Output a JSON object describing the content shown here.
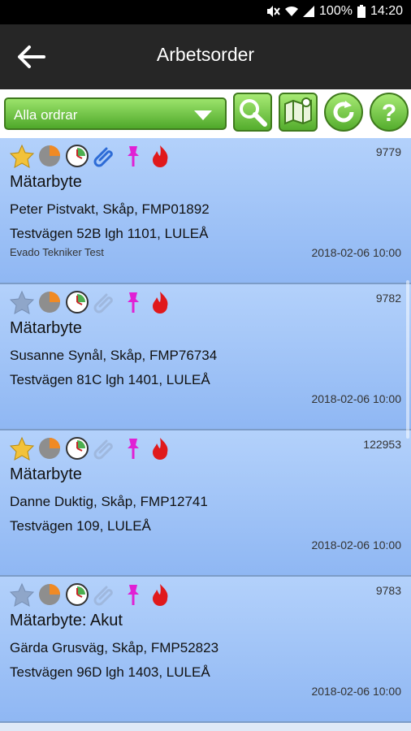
{
  "status": {
    "battery": "100%",
    "time": "14:20"
  },
  "header": {
    "title": "Arbetsorder"
  },
  "toolbar": {
    "filter_value": "Alla ordrar",
    "accent": "#58b02f"
  },
  "orders": [
    {
      "number": "9779",
      "type": "Mätarbyte",
      "customer": "Peter Pistvakt, Skåp, FMP01892",
      "address": "Testvägen 52B lgh 1101, LULEÅ",
      "technician": "Evado Tekniker Test",
      "date": "2018-02-06 10:00",
      "starred": true,
      "attachment": true
    },
    {
      "number": "9782",
      "type": "Mätarbyte",
      "customer": "Susanne Synål, Skåp, FMP76734",
      "address": "Testvägen 81C lgh 1401, LULEÅ",
      "technician": "",
      "date": "2018-02-06 10:00",
      "starred": false,
      "attachment": false
    },
    {
      "number": "122953",
      "type": "Mätarbyte",
      "customer": "Danne Duktig, Skåp, FMP12741",
      "address": "Testvägen 109, LULEÅ",
      "technician": "",
      "date": "2018-02-06 10:00",
      "starred": true,
      "attachment": false
    },
    {
      "number": "9783",
      "type": "Mätarbyte: Akut",
      "customer": "Gärda Grusväg, Skåp, FMP52823",
      "address": "Testvägen 96D lgh 1403, LULEÅ",
      "technician": "",
      "date": "2018-02-06 10:00",
      "starred": false,
      "attachment": false
    }
  ],
  "icons": [
    "star-icon",
    "progress-pie-icon",
    "clock-icon",
    "paperclip-icon",
    "pushpin-icon",
    "flame-icon"
  ]
}
